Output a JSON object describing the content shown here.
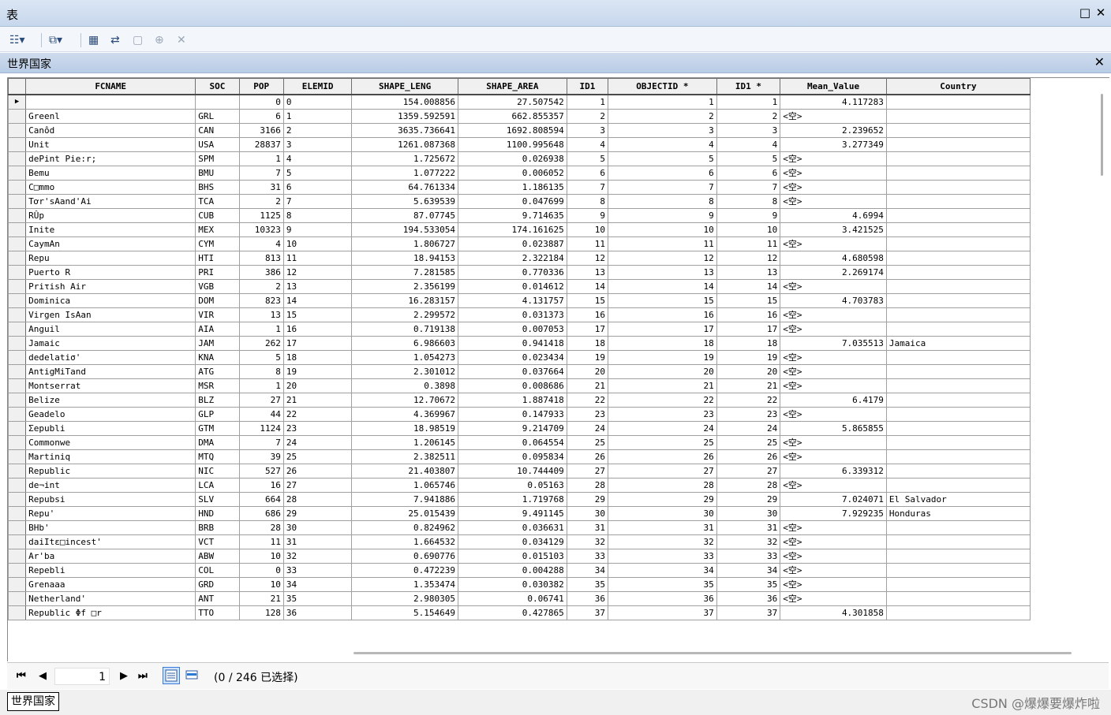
{
  "window": {
    "title": "表",
    "restore_glyph": "□",
    "close_glyph": "✕"
  },
  "toolbar": {
    "buttons": [
      {
        "name": "table-options-icon",
        "glyph": "☷▾"
      },
      {
        "name": "related-tables-icon",
        "glyph": "⧉▾"
      },
      {
        "name": "select-by-attributes-icon",
        "glyph": "▦"
      },
      {
        "name": "switch-selection-icon",
        "glyph": "⇄"
      },
      {
        "name": "clear-selection-icon",
        "glyph": "▢"
      },
      {
        "name": "zoom-to-selected-icon",
        "glyph": "⊕"
      },
      {
        "name": "delete-selected-icon",
        "glyph": "✕"
      }
    ]
  },
  "tab": {
    "title": "世界国家",
    "close_glyph": "✕"
  },
  "table": {
    "columns": [
      "FCNAME",
      "SOC",
      "POP",
      "ELEMID",
      "SHAPE_LENG",
      "SHAPE_AREA",
      "ID1",
      "OBJECTID *",
      "ID1 *",
      "Mean_Value",
      "Country"
    ],
    "current_row_marker": "▶",
    "rows": [
      [
        "",
        "",
        "0",
        "0",
        "154.008856",
        "27.507542",
        "1",
        "1",
        "1",
        "4.117283",
        ""
      ],
      [
        "Greenl",
        "GRL",
        "6",
        "1",
        "1359.592591",
        "662.855357",
        "2",
        "2",
        "2",
        "<空>",
        ""
      ],
      [
        "Canôd",
        "CAN",
        "3166",
        "2",
        "3635.736641",
        "1692.808594",
        "3",
        "3",
        "3",
        "2.239652",
        ""
      ],
      [
        "Unit",
        "USA",
        "28837",
        "3",
        "1261.087368",
        "1100.995648",
        "4",
        "4",
        "4",
        "3.277349",
        ""
      ],
      [
        "dePint Pie:r;",
        "SPM",
        "1",
        "4",
        "1.725672",
        "0.026938",
        "5",
        "5",
        "5",
        "<空>",
        ""
      ],
      [
        "Bemu",
        "BMU",
        "7",
        "5",
        "1.077222",
        "0.006052",
        "6",
        "6",
        "6",
        "<空>",
        ""
      ],
      [
        "C□mmo",
        "BHS",
        "31",
        "6",
        "64.761334",
        "1.186135",
        "7",
        "7",
        "7",
        "<空>",
        ""
      ],
      [
        "Tơr'sAand'Ai",
        "TCA",
        "2",
        "7",
        "5.639539",
        "0.047699",
        "8",
        "8",
        "8",
        "<空>",
        ""
      ],
      [
        "RÛp",
        "CUB",
        "1125",
        "8",
        "87.07745",
        "9.714635",
        "9",
        "9",
        "9",
        "4.6994",
        ""
      ],
      [
        "Inite",
        "MEX",
        "10323",
        "9",
        "194.533054",
        "174.161625",
        "10",
        "10",
        "10",
        "3.421525",
        ""
      ],
      [
        "CaymAn",
        "CYM",
        "4",
        "10",
        "1.806727",
        "0.023887",
        "11",
        "11",
        "11",
        "<空>",
        ""
      ],
      [
        "Repu",
        "HTI",
        "813",
        "11",
        "18.94153",
        "2.322184",
        "12",
        "12",
        "12",
        "4.680598",
        ""
      ],
      [
        "Puerto R",
        "PRI",
        "386",
        "12",
        "7.281585",
        "0.770336",
        "13",
        "13",
        "13",
        "2.269174",
        ""
      ],
      [
        "Priτish Air",
        "VGB",
        "2",
        "13",
        "2.356199",
        "0.014612",
        "14",
        "14",
        "14",
        "<空>",
        ""
      ],
      [
        "Dominica",
        "DOM",
        "823",
        "14",
        "16.283157",
        "4.131757",
        "15",
        "15",
        "15",
        "4.703783",
        ""
      ],
      [
        "Virgen IsAan",
        "VIR",
        "13",
        "15",
        "2.299572",
        "0.031373",
        "16",
        "16",
        "16",
        "<空>",
        ""
      ],
      [
        "Anguil",
        "AIA",
        "1",
        "16",
        "0.719138",
        "0.007053",
        "17",
        "17",
        "17",
        "<空>",
        ""
      ],
      [
        "Jamaic",
        "JAM",
        "262",
        "17",
        "6.986603",
        "0.941418",
        "18",
        "18",
        "18",
        "7.035513",
        "Jamaica"
      ],
      [
        "dedelatiσ'",
        "KNA",
        "5",
        "18",
        "1.054273",
        "0.023434",
        "19",
        "19",
        "19",
        "<空>",
        ""
      ],
      [
        "AntigMiTand",
        "ATG",
        "8",
        "19",
        "2.301012",
        "0.037664",
        "20",
        "20",
        "20",
        "<空>",
        ""
      ],
      [
        "Montserrat",
        "MSR",
        "1",
        "20",
        "0.3898",
        "0.008686",
        "21",
        "21",
        "21",
        "<空>",
        ""
      ],
      [
        "Belize",
        "BLZ",
        "27",
        "21",
        "12.70672",
        "1.887418",
        "22",
        "22",
        "22",
        "6.4179",
        ""
      ],
      [
        "Geadelo",
        "GLP",
        "44",
        "22",
        "4.369967",
        "0.147933",
        "23",
        "23",
        "23",
        "<空>",
        ""
      ],
      [
        "Σepubli",
        "GTM",
        "1124",
        "23",
        "18.98519",
        "9.214709",
        "24",
        "24",
        "24",
        "5.865855",
        ""
      ],
      [
        "Commonwe",
        "DMA",
        "7",
        "24",
        "1.206145",
        "0.064554",
        "25",
        "25",
        "25",
        "<空>",
        ""
      ],
      [
        "Martiniq",
        "MTQ",
        "39",
        "25",
        "2.382511",
        "0.095834",
        "26",
        "26",
        "26",
        "<空>",
        ""
      ],
      [
        "Republic",
        "NIC",
        "527",
        "26",
        "21.403807",
        "10.744409",
        "27",
        "27",
        "27",
        "6.339312",
        ""
      ],
      [
        "de¬int",
        "LCA",
        "16",
        "27",
        "1.065746",
        "0.05163",
        "28",
        "28",
        "28",
        "<空>",
        ""
      ],
      [
        "Repubsi",
        "SLV",
        "664",
        "28",
        "7.941886",
        "1.719768",
        "29",
        "29",
        "29",
        "7.024071",
        "El Salvador"
      ],
      [
        "Repu'",
        "HND",
        "686",
        "29",
        "25.015439",
        "9.491145",
        "30",
        "30",
        "30",
        "7.929235",
        "Honduras"
      ],
      [
        "BHb'",
        "BRB",
        "28",
        "30",
        "0.824962",
        "0.036631",
        "31",
        "31",
        "31",
        "<空>",
        ""
      ],
      [
        "daiItε□incest'",
        "VCT",
        "11",
        "31",
        "1.664532",
        "0.034129",
        "32",
        "32",
        "32",
        "<空>",
        ""
      ],
      [
        "Ar'ba",
        "ABW",
        "10",
        "32",
        "0.690776",
        "0.015103",
        "33",
        "33",
        "33",
        "<空>",
        ""
      ],
      [
        "Repebli",
        "COL",
        "0",
        "33",
        "0.472239",
        "0.004288",
        "34",
        "34",
        "34",
        "<空>",
        ""
      ],
      [
        "Grenaaa",
        "GRD",
        "10",
        "34",
        "1.353474",
        "0.030382",
        "35",
        "35",
        "35",
        "<空>",
        ""
      ],
      [
        "Netherland'",
        "ANT",
        "21",
        "35",
        "2.980305",
        "0.06741",
        "36",
        "36",
        "36",
        "<空>",
        ""
      ],
      [
        "Republic Φf □r",
        "TTO",
        "128",
        "36",
        "5.154649",
        "0.427865",
        "37",
        "37",
        "37",
        "4.301858",
        ""
      ]
    ]
  },
  "status": {
    "page_value": "1",
    "selection_text": "(0 / 246 已选择)",
    "nav": {
      "first": "⏮",
      "prev": "◀",
      "next": "▶",
      "last": "⏭"
    }
  },
  "bottom": {
    "tab_label": "世界国家",
    "watermark": "CSDN @爆爆要爆炸啦"
  },
  "colors": {
    "titlebar": "#c7d7ec",
    "tabbar": "#b9cce6",
    "header_bg": "#f0f0f0"
  }
}
